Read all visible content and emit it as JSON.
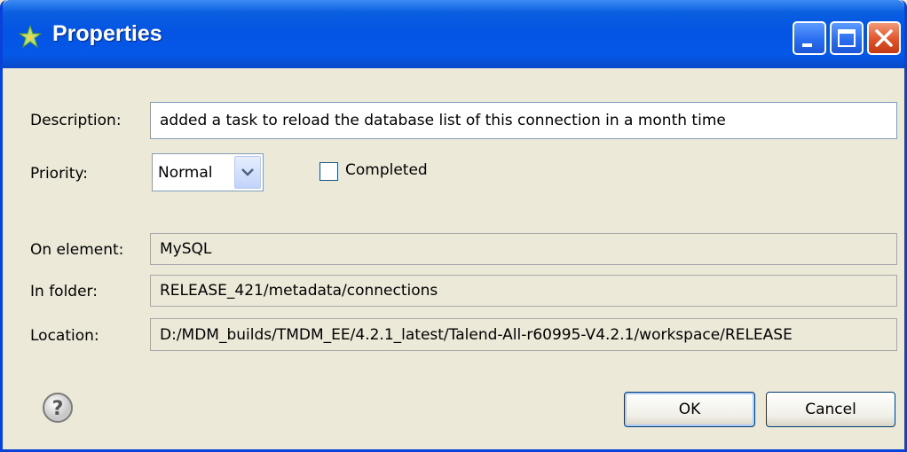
{
  "window": {
    "title": "Properties"
  },
  "form": {
    "description_label": "Description:",
    "description_value": "added a task to reload the database list of this connection in a month time",
    "priority_label": "Priority:",
    "priority_value": "Normal",
    "completed_label": "Completed",
    "completed_checked": false,
    "on_element_label": "On element:",
    "on_element_value": "MySQL",
    "in_folder_label": "In folder:",
    "in_folder_value": "RELEASE_421/metadata/connections",
    "location_label": "Location:",
    "location_value": "D:/MDM_builds/TMDM_EE/4.2.1_latest/Talend-All-r60995-V4.2.1/workspace/RELEASE"
  },
  "buttons": {
    "ok": "OK",
    "cancel": "Cancel"
  },
  "icons": {
    "app": "star-icon",
    "help": "help-icon"
  },
  "colors": {
    "titlebar": "#0554e3",
    "close": "#e0532c",
    "dialog_bg": "#ece9d8"
  }
}
